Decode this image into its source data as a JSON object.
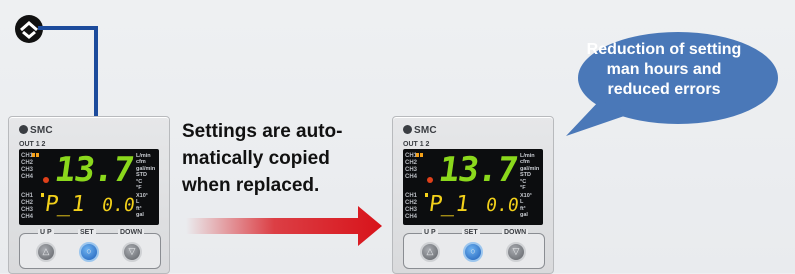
{
  "callout": {
    "lines": [
      "Settings are auto-",
      "matically copied",
      "when replaced."
    ]
  },
  "bubble": {
    "lines": [
      "Reduction of setting",
      "man hours and",
      "reduced errors"
    ],
    "color": "#4a78b8"
  },
  "devices": [
    {
      "brand": "SMC",
      "out_label": "OUT 1 2",
      "channels_top": [
        "CH1",
        "CH2",
        "CH3",
        "CH4"
      ],
      "channels_bottom": [
        "CH1",
        "CH2",
        "CH3",
        "CH4"
      ],
      "main_value": "13.7",
      "sub_left": "P_1",
      "sub_right": "0.0",
      "units_top": [
        "L/min",
        "cfm",
        "gal/min",
        "STD",
        "°C",
        "°F"
      ],
      "units_bottom": [
        "X10³",
        "L",
        "ft³",
        "gal"
      ],
      "buttons": {
        "up_label": "U P",
        "set_label": "SET",
        "down_label": "DOWN"
      }
    },
    {
      "brand": "SMC",
      "out_label": "OUT 1 2",
      "channels_top": [
        "CH1",
        "CH2",
        "CH3",
        "CH4"
      ],
      "channels_bottom": [
        "CH1",
        "CH2",
        "CH3",
        "CH4"
      ],
      "main_value": "13.7",
      "sub_left": "P_1",
      "sub_right": "0.0",
      "units_top": [
        "L/min",
        "cfm",
        "gal/min",
        "STD",
        "°C",
        "°F"
      ],
      "units_bottom": [
        "X10³",
        "L",
        "ft³",
        "gal"
      ],
      "buttons": {
        "up_label": "U P",
        "set_label": "SET",
        "down_label": "DOWN"
      }
    }
  ],
  "colors": {
    "cable": "#1c4b9c",
    "arrow": "#d8131a",
    "display_main": "#8bd81c",
    "display_sub": "#f2d01a"
  },
  "icons": {
    "connector": "connector-icon"
  }
}
